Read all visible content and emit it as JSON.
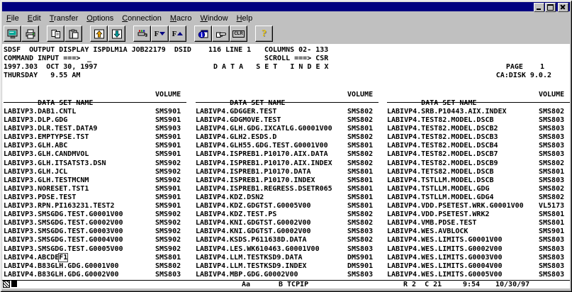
{
  "menu": {
    "items": [
      "File",
      "Edit",
      "Transfer",
      "Options",
      "Connection",
      "Macro",
      "Window",
      "Help"
    ]
  },
  "toolbar": {
    "font_decrease_label": "F",
    "font_increase_label": "F",
    "clear_label": "CLR",
    "help_label": "?"
  },
  "terminal": {
    "line1_left": "SDSF  OUTPUT DISPLAY ISPDLM1A JOB22179  DSID    116 LINE 1",
    "line1_right": "COLUMNS 02- 133",
    "line2_left": "COMMAND INPUT ===>",
    "line2_cursor": "_",
    "line2_right": "SCROLL ===> CSR",
    "line3_left": "1997.303  OCT 30, 1997",
    "line3_center": "D A T A   S E T   I N D E X",
    "line3_right": "PAGE    1",
    "line4_left": "THURSDAY   9.55 AM",
    "line4_right": "CA:DISK 9.0.2"
  },
  "dataset_columns": [
    {
      "header": "DATA SET NAME",
      "volume_header": "VOLUME",
      "rows": [
        {
          "name": "LABIVP3.DAB1.CNTL",
          "vol": "SMS901"
        },
        {
          "name": "LABIVP3.DLP.GDG",
          "vol": "SMS901"
        },
        {
          "name": "LABIVP3.DLR.TEST.DATA9",
          "vol": "SMS903"
        },
        {
          "name": "LABIVP3.EMPTYPSE.TST",
          "vol": "SMS901"
        },
        {
          "name": "LABIVP3.GLH.ABC",
          "vol": "SMS901"
        },
        {
          "name": "LABIVP3.GLH.CANDMVOL",
          "vol": "SMS901"
        },
        {
          "name": "LABIVP3.GLH.ITSATST3.DSN",
          "vol": "SMS902"
        },
        {
          "name": "LABIVP3.GLH.JCL",
          "vol": "SMS902"
        },
        {
          "name": "LABIVP3.GLH.TESTMCNM",
          "vol": "SMS902"
        },
        {
          "name": "LABIVP3.NORESET.TST1",
          "vol": "SMS901"
        },
        {
          "name": "LABIVP3.PDSE.TEST",
          "vol": "SMS901"
        },
        {
          "name": "LABIVP3.RPN.PI163231.TEST2",
          "vol": "SMS901"
        },
        {
          "name": "LABIVP3.SMSGDG.TEST.G0001V00",
          "vol": "SMS902"
        },
        {
          "name": "LABIVP3.SMSGDG.TEST.G0002V00",
          "vol": "SMS902"
        },
        {
          "name": "LABIVP3.SMSGDG.TEST.G0003V00",
          "vol": "SMS902"
        },
        {
          "name": "LABIVP3.SMSGDG.TEST.G0004V00",
          "vol": "SMS902"
        },
        {
          "name": "LABIVP3.SMSGDG.TEST.G0005V00",
          "vol": "SMS902"
        },
        {
          "name": "LABIVP4.ABCDEF1",
          "boxed": "F1",
          "vol": "SMS801"
        },
        {
          "name": "LABIVP4.B83GLH.GDG.G0001V00",
          "vol": "SMS802"
        },
        {
          "name": "LABIVP4.B83GLH.GDG.G0002V00",
          "vol": "SMS803"
        }
      ]
    },
    {
      "header": "DATA SET NAME",
      "volume_header": "VOLUME",
      "rows": [
        {
          "name": "LABIVP4.GDGGER.TEST",
          "vol": "SMS802"
        },
        {
          "name": "LABIVP4.GDGMOVE.TEST",
          "vol": "SMS802"
        },
        {
          "name": "LABIVP4.GLH.GDG.IXCATLG.G0001V00",
          "vol": "SMS801"
        },
        {
          "name": "LABIVP4.GLH2.ESDS.D",
          "vol": "SMS802"
        },
        {
          "name": "LABIVP4.GLH55.GDG.TEST.G0001V00",
          "vol": "SMS801"
        },
        {
          "name": "LABIVP4.ISPREB1.P10170.AIX.DATA",
          "vol": "SMS802"
        },
        {
          "name": "LABIVP4.ISPREB1.P10170.AIX.INDEX",
          "vol": "SMS802"
        },
        {
          "name": "LABIVP4.ISPREB1.P10170.DATA",
          "vol": "SMS801"
        },
        {
          "name": "LABIVP4.ISPREB1.P10170.INDEX",
          "vol": "SMS801"
        },
        {
          "name": "LABIVP4.ISPREB1.REGRESS.DSETR065",
          "vol": "SMS801"
        },
        {
          "name": "LABIVP4.KDZ.DSN2",
          "vol": "SMS801"
        },
        {
          "name": "LABIVP4.KDZ.GDGTST.G0005V00",
          "vol": "SMS801"
        },
        {
          "name": "LABIVP4.KDZ.TEST.PS",
          "vol": "SMS802"
        },
        {
          "name": "LABIVP4.KNI.GDGTST.G0002V00",
          "vol": "SMS802"
        },
        {
          "name": "LABIVP4.KNI.GDGTST.G0002V00",
          "vol": "SMS803"
        },
        {
          "name": "LABIVP4.KSDS.P611638D.DATA",
          "vol": "SMS802"
        },
        {
          "name": "LABIVP4.LES.WK610463.G0001V00",
          "vol": "SMS803"
        },
        {
          "name": "LABIVP4.LLM.TESTKSD9.DATA",
          "vol": "DMS901"
        },
        {
          "name": "LABIVP4.LLM.TESTKSD9.INDEX",
          "vol": "DMS901"
        },
        {
          "name": "LABIVP4.MBP.GDG.G0002V00",
          "vol": "SMS803"
        }
      ]
    },
    {
      "header": "DATA SET NAME",
      "volume_header": "VOLUME",
      "rows": [
        {
          "name": "LABIVP4.SRB.P10443.AIX.INDEX",
          "vol": "SMS802"
        },
        {
          "name": "LABIVP4.TEST82.MODEL.DSCB",
          "vol": "SMS803"
        },
        {
          "name": "LABIVP4.TEST82.MODEL.DSCB2",
          "vol": "SMS803"
        },
        {
          "name": "LABIVP4.TEST82.MODEL.DSCB3",
          "vol": "SMS803"
        },
        {
          "name": "LABIVP4.TEST82.MODEL.DSCB4",
          "vol": "SMS803"
        },
        {
          "name": "LABIVP4.TEST82.MODEL.DSCB7",
          "vol": "SMS803"
        },
        {
          "name": "LABIVP4.TEST82.MODEL.DSCB9",
          "vol": "SMS802"
        },
        {
          "name": "LABIVP4.TETS82.MODEL.DSCB",
          "vol": "SMS801"
        },
        {
          "name": "LABIVP4.TSTLLM.MODEL.DSCB",
          "vol": "SMS803"
        },
        {
          "name": "LABIVP4.TSTLLM.MODEL.GDG",
          "vol": "SMS802"
        },
        {
          "name": "LABIVP4.TSTLLM.MODEL.GDG4",
          "vol": "SMS802"
        },
        {
          "name": "LABIVP4.VDD.PSETEST.WRK.G0001V00",
          "vol": "VL5173"
        },
        {
          "name": "LABIVP4.VDD.PSETEST.WRK2",
          "vol": "SMS801"
        },
        {
          "name": "LABIVP4.VMB.PDSE.TEST",
          "vol": "SMS801"
        },
        {
          "name": "LABIVP4.WES.AVBLOCK",
          "vol": "SMS901"
        },
        {
          "name": "LABIVP4.WES.LIMITS.G0001V00",
          "vol": "SMS803"
        },
        {
          "name": "LABIVP4.WES.LIMITS.G0002V00",
          "vol": "SMS803"
        },
        {
          "name": "LABIVP4.WES.LIMITS.G0003V00",
          "vol": "SMS803"
        },
        {
          "name": "LABIVP4.WES.LIMITS.G0004V00",
          "vol": "SMS803"
        },
        {
          "name": "LABIVP4.WES.LIMITS.G0005V00",
          "vol": "SMS803"
        }
      ]
    }
  ],
  "oia": {
    "aa": "Aa",
    "connection": "B TCPIP",
    "row_col": "R 2  C 21",
    "time": "9:54",
    "date": "10/30/97"
  }
}
